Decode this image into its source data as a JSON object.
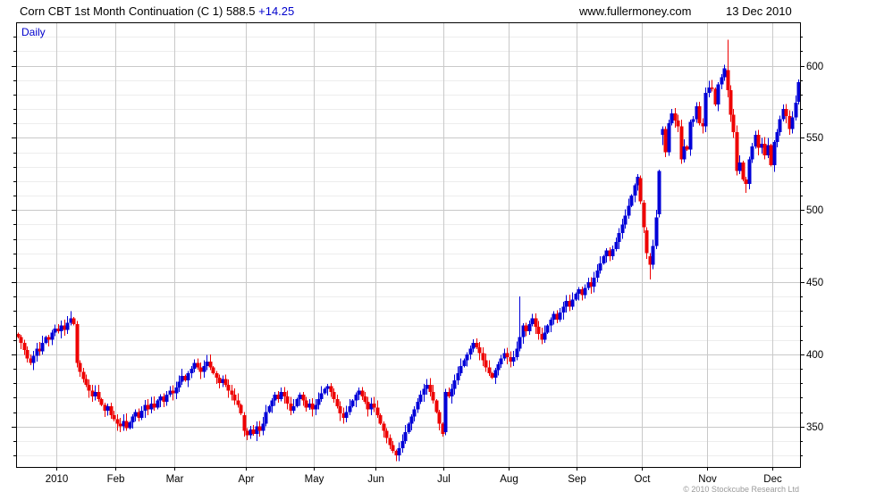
{
  "header": {
    "title": "Corn CBT 1st Month Continuation (C 1) 588.5 ",
    "change": "+14.25",
    "website": "www.fullermoney.com",
    "date": "13 Dec 2010"
  },
  "plot": {
    "interval_label": "Daily",
    "copyright": "© 2010 Stockcube Research Ltd"
  },
  "colors": {
    "up": "#0000d8",
    "down": "#ee0000",
    "grid_major": "#c9c9c9",
    "grid_minor": "#ededed",
    "frame": "#000000",
    "text_blue": "#0000cc",
    "copyright_gray": "#9a9a9a"
  },
  "chart_data": {
    "type": "candlestick",
    "title": "Corn CBT 1st Month Continuation (C 1)",
    "interval": "Daily",
    "last_price": 588.5,
    "change": 14.25,
    "ylim": [
      322,
      630
    ],
    "y_major_ticks": [
      350,
      400,
      450,
      500,
      550,
      600
    ],
    "y_minor_step": 10,
    "grid": true,
    "first_open": 414,
    "months": [
      {
        "label": "2010",
        "index": 13
      },
      {
        "label": "Feb",
        "index": 32
      },
      {
        "label": "Mar",
        "index": 51
      },
      {
        "label": "Apr",
        "index": 74
      },
      {
        "label": "May",
        "index": 96
      },
      {
        "label": "Jun",
        "index": 116
      },
      {
        "label": "Jul",
        "index": 138
      },
      {
        "label": "Aug",
        "index": 159
      },
      {
        "label": "Sep",
        "index": 181
      },
      {
        "label": "Oct",
        "index": 202
      },
      {
        "label": "Nov",
        "index": 223
      },
      {
        "label": "Dec",
        "index": 244
      }
    ],
    "closes": [
      412,
      408,
      403,
      397,
      394,
      399,
      404,
      402,
      408,
      412,
      410,
      415,
      418,
      416,
      420,
      417,
      422,
      425,
      421,
      394,
      388,
      383,
      379,
      375,
      371,
      374,
      369,
      365,
      361,
      364,
      358,
      355,
      352,
      350,
      354,
      349,
      353,
      357,
      360,
      356,
      361,
      365,
      362,
      366,
      363,
      368,
      371,
      367,
      372,
      375,
      373,
      377,
      381,
      385,
      382,
      387,
      390,
      394,
      391,
      388,
      392,
      395,
      391,
      387,
      384,
      380,
      383,
      379,
      375,
      372,
      368,
      365,
      359,
      347,
      344,
      348,
      345,
      350,
      347,
      352,
      360,
      364,
      368,
      372,
      369,
      374,
      371,
      366,
      361,
      364,
      369,
      372,
      368,
      363,
      366,
      362,
      365,
      369,
      373,
      376,
      378,
      374,
      369,
      364,
      359,
      356,
      360,
      364,
      368,
      372,
      375,
      371,
      367,
      362,
      366,
      363,
      358,
      352,
      347,
      342,
      337,
      333,
      330,
      335,
      340,
      346,
      352,
      357,
      362,
      367,
      372,
      376,
      379,
      374,
      368,
      360,
      352,
      345,
      374,
      371,
      376,
      382,
      387,
      392,
      396,
      400,
      404,
      408,
      405,
      401,
      396,
      391,
      387,
      384,
      389,
      393,
      397,
      401,
      398,
      395,
      398,
      404,
      412,
      420,
      416,
      421,
      425,
      419,
      414,
      410,
      415,
      420,
      424,
      428,
      424,
      429,
      433,
      437,
      433,
      438,
      442,
      445,
      441,
      446,
      450,
      447,
      453,
      458,
      463,
      468,
      472,
      468,
      473,
      478,
      484,
      490,
      496,
      503,
      510,
      517,
      523,
      506,
      488,
      470,
      462,
      475,
      495,
      527,
      556,
      540,
      560,
      567,
      562,
      558,
      535,
      544,
      542,
      561,
      563,
      572,
      560,
      558,
      581,
      585,
      584,
      573,
      587,
      592,
      598,
      583,
      566,
      554,
      527,
      533,
      521,
      518,
      535,
      544,
      552,
      543,
      546,
      538,
      545,
      531,
      547,
      554,
      563,
      570,
      565,
      556,
      564,
      574.25,
      588.5
    ],
    "specials": {
      "19": [
        421,
        423,
        391,
        394
      ],
      "73": [
        358,
        360,
        343,
        347
      ],
      "122": [
        333,
        334,
        326,
        330
      ],
      "137": [
        352,
        353,
        343,
        345
      ],
      "138": [
        346,
        376,
        344,
        374
      ],
      "162": [
        404,
        440,
        402,
        412
      ],
      "201": [
        522,
        524,
        504,
        506
      ],
      "202": [
        505,
        507,
        484,
        488
      ],
      "203": [
        486,
        488,
        466,
        470
      ],
      "204": [
        468,
        470,
        452,
        462
      ],
      "207": [
        497,
        528,
        495,
        527
      ],
      "208": [
        552,
        558,
        545,
        556
      ],
      "229": [
        597,
        618,
        578,
        583
      ],
      "235": [
        521,
        523,
        512,
        518
      ],
      "252": [
        575,
        590.5,
        573,
        588.5
      ]
    }
  }
}
